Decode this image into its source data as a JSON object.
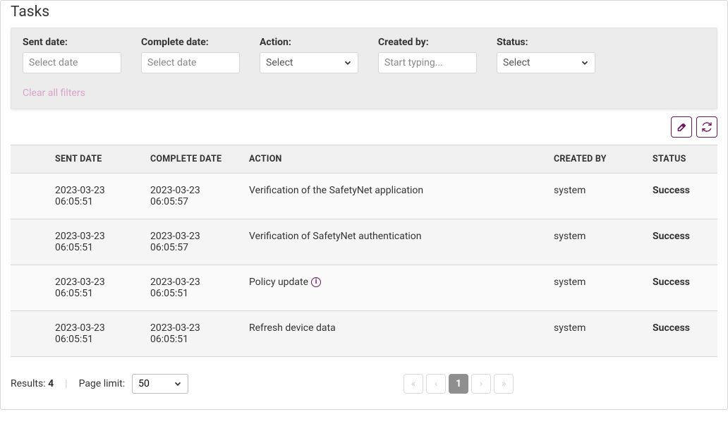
{
  "title": "Tasks",
  "filters": {
    "sent_date": {
      "label": "Sent date:",
      "placeholder": "Select date"
    },
    "complete_date": {
      "label": "Complete date:",
      "placeholder": "Select date"
    },
    "action": {
      "label": "Action:",
      "placeholder": "Select"
    },
    "created_by": {
      "label": "Created by:",
      "placeholder": "Start typing..."
    },
    "status": {
      "label": "Status:",
      "placeholder": "Select"
    },
    "clear": "Clear all filters"
  },
  "columns": {
    "sent": "SENT DATE",
    "complete": "COMPLETE DATE",
    "action": "ACTION",
    "created": "CREATED BY",
    "status": "STATUS"
  },
  "rows": [
    {
      "sent_d": "2023-03-23",
      "sent_t": "06:05:51",
      "comp_d": "2023-03-23",
      "comp_t": "06:05:57",
      "action": "Verification of the SafetyNet application",
      "info": false,
      "created": "system",
      "status": "Success"
    },
    {
      "sent_d": "2023-03-23",
      "sent_t": "06:05:51",
      "comp_d": "2023-03-23",
      "comp_t": "06:05:57",
      "action": "Verification of SafetyNet authentication",
      "info": false,
      "created": "system",
      "status": "Success"
    },
    {
      "sent_d": "2023-03-23",
      "sent_t": "06:05:51",
      "comp_d": "2023-03-23",
      "comp_t": "06:05:51",
      "action": "Policy update",
      "info": true,
      "created": "system",
      "status": "Success"
    },
    {
      "sent_d": "2023-03-23",
      "sent_t": "06:05:51",
      "comp_d": "2023-03-23",
      "comp_t": "06:05:51",
      "action": "Refresh device data",
      "info": false,
      "created": "system",
      "status": "Success"
    }
  ],
  "footer": {
    "results_label": "Results:",
    "results_count": "4",
    "page_limit_label": "Page limit:",
    "page_limit_value": "50",
    "current_page": "1"
  }
}
